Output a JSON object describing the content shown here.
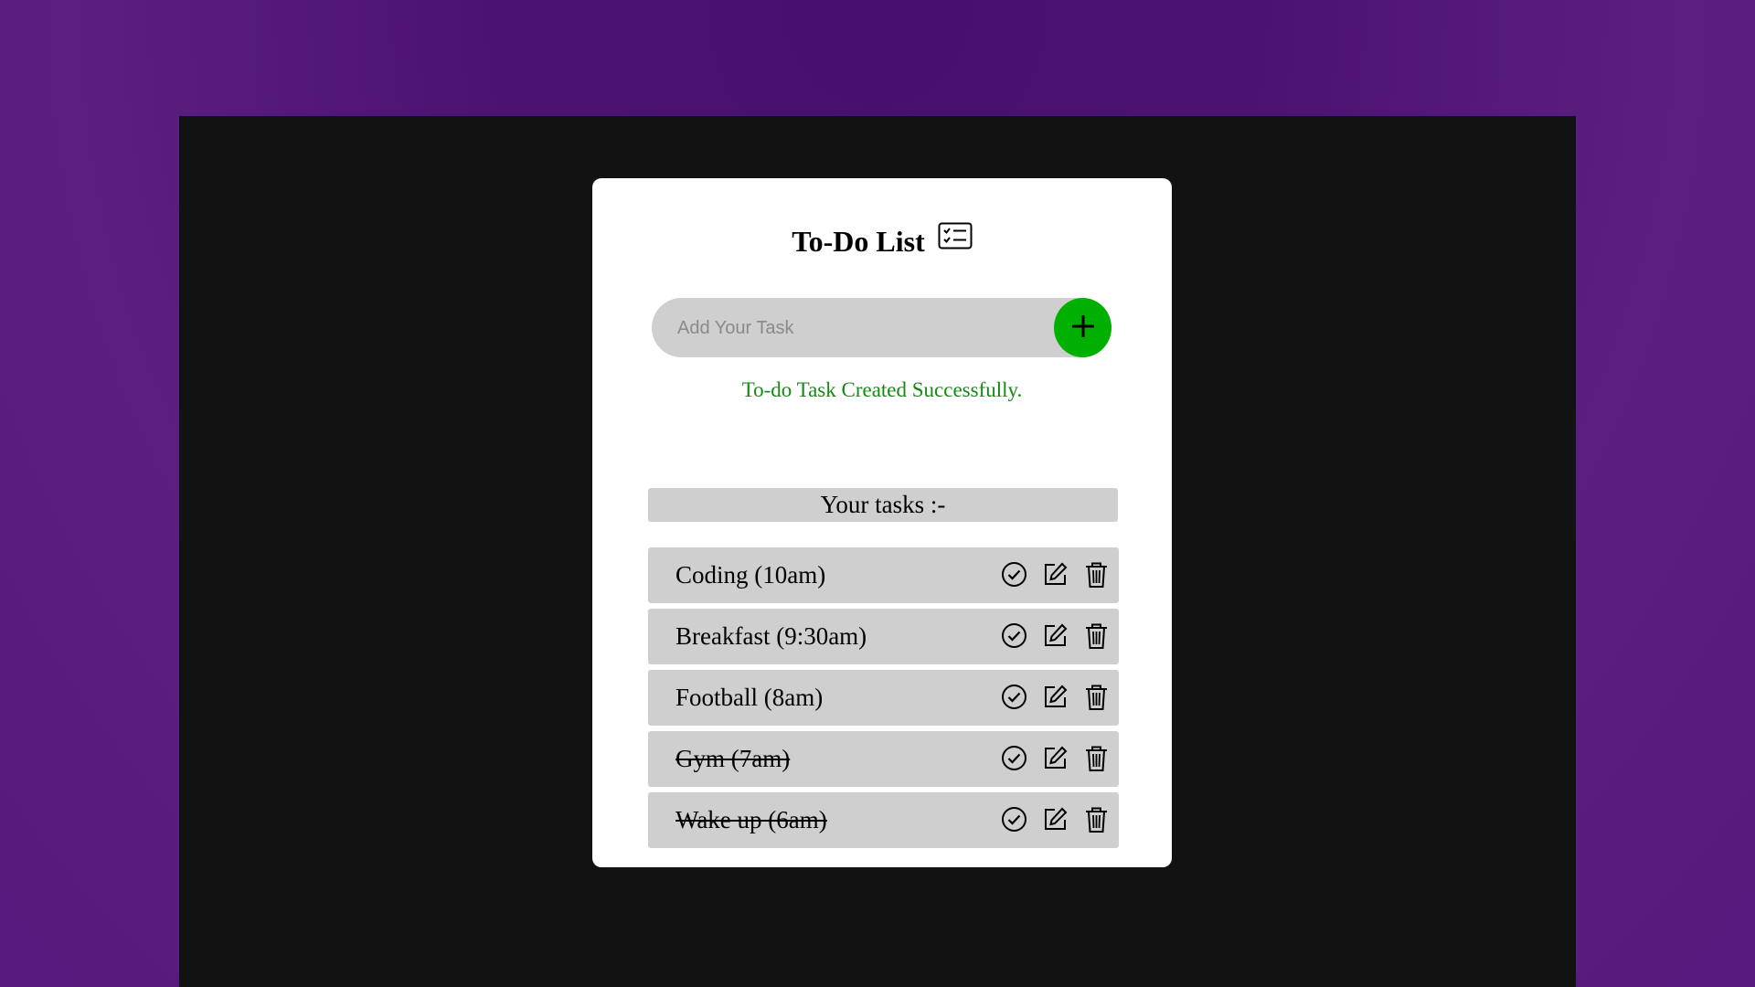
{
  "app": {
    "title": "To-Do List",
    "title_icon": "list-check-icon"
  },
  "input": {
    "placeholder": "Add Your Task",
    "value": "",
    "add_icon": "plus-icon",
    "add_button_color": "#00b000"
  },
  "status": {
    "message": "To-do Task Created Successfully.",
    "color": "#138a13"
  },
  "tasks_header": "Your tasks :-",
  "tasks": [
    {
      "label": "Coding (10am)",
      "completed": false
    },
    {
      "label": "Breakfast (9:30am)",
      "completed": false
    },
    {
      "label": "Football (8am)",
      "completed": false
    },
    {
      "label": "Gym (7am)",
      "completed": true
    },
    {
      "label": "Wake up (6am)",
      "completed": true
    }
  ],
  "task_action_icons": [
    "check-circle-icon",
    "edit-icon",
    "trash-icon"
  ]
}
